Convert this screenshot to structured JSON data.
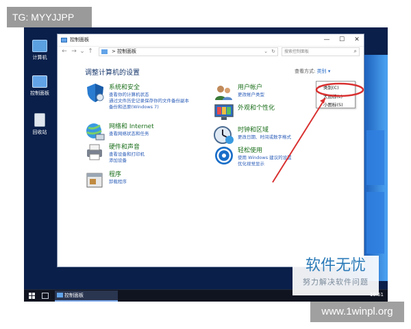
{
  "watermark_tag": "TG: MYYJJPP",
  "site_label": "www.1winpl.org",
  "brand_logo": {
    "title": "软件无忧",
    "subtitle": "努力解决软件问题"
  },
  "desktop_icons": [
    {
      "label": "计算机",
      "icon": "computer-icon"
    },
    {
      "label": "控制面板",
      "icon": "control-panel-icon"
    },
    {
      "label": "回收站",
      "icon": "recycle-bin-icon"
    }
  ],
  "window": {
    "title": "控制面板",
    "controls": {
      "minimize": "—",
      "maximize": "☐",
      "close": "✕"
    },
    "nav": {
      "back": "←",
      "forward": "→",
      "recent": "⌄",
      "up": "↑"
    },
    "address": {
      "separator": ">",
      "path": "控制面板",
      "dropdown": "⌄",
      "refresh": "↻"
    },
    "search_placeholder": "搜索控制面板",
    "heading": "调整计算机的设置",
    "view_by": {
      "label": "查看方式:",
      "value": "类别 ▾"
    },
    "view_options": [
      "类别(C)",
      "大图标(L)",
      "小图标(S)"
    ],
    "selected_view": "类别(C)"
  },
  "categories": [
    {
      "title": "系统和安全",
      "icon": "shield-icon",
      "links": [
        "查看你的计算机状态",
        "通过文件历史记录保存你的文件备份副本",
        "备份和还原(Windows 7)"
      ]
    },
    {
      "title": "网络和 Internet",
      "icon": "network-icon",
      "links": [
        "查看网络状态和任务"
      ]
    },
    {
      "title": "硬件和声音",
      "icon": "printer-icon",
      "links": [
        "查看设备和打印机",
        "添加设备"
      ]
    },
    {
      "title": "程序",
      "icon": "programs-icon",
      "links": [
        "卸载程序"
      ]
    },
    {
      "title": "用户帐户",
      "icon": "users-icon",
      "links": [
        "更改帐户类型"
      ]
    },
    {
      "title": "外观和个性化",
      "icon": "display-icon",
      "links": []
    },
    {
      "title": "时钟和区域",
      "icon": "clock-icon",
      "links": [
        "更改日期、时间或数字格式"
      ]
    },
    {
      "title": "轻松使用",
      "icon": "accessibility-icon",
      "links": [
        "使用 Windows 建议的设置",
        "优化视觉显示"
      ]
    }
  ],
  "taskbar": {
    "task_label": "控制面板",
    "clock": "10:51"
  },
  "colors": {
    "annotation": "#d93030",
    "category_title": "#1a6e1a",
    "link": "#2a5cb8",
    "desktop": "#0a1f4a"
  }
}
